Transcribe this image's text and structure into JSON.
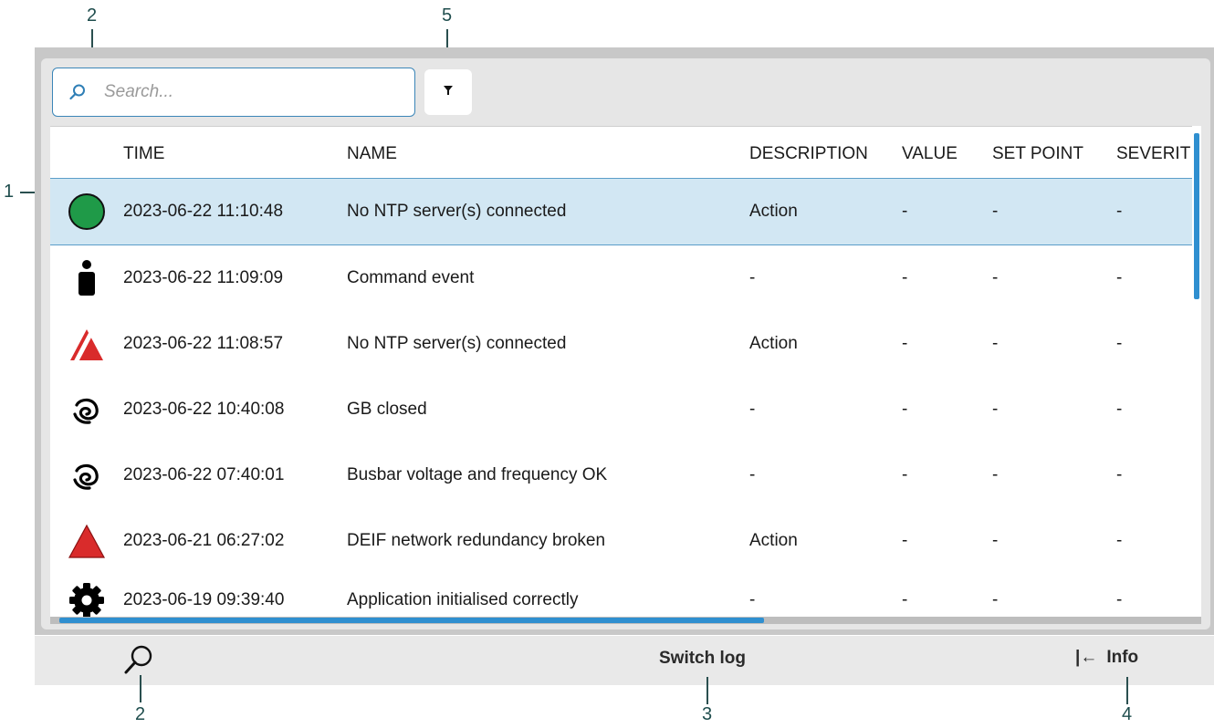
{
  "callouts": {
    "top_search": "2",
    "top_filter": "5",
    "row": "1",
    "bottom_search": "2",
    "bottom_switch": "3",
    "bottom_info": "4"
  },
  "search": {
    "placeholder": "Search..."
  },
  "columns": {
    "time": "TIME",
    "name": "NAME",
    "description": "DESCRIPTION",
    "value": "VALUE",
    "set_point": "SET POINT",
    "severity": "SEVERIT"
  },
  "rows": [
    {
      "icon": "green-circle-icon",
      "time": "2023-06-22 11:10:48",
      "name": "No NTP server(s) connected",
      "description": "Action",
      "value": "-",
      "set_point": "-",
      "severity": "-"
    },
    {
      "icon": "person-icon",
      "time": "2023-06-22 11:09:09",
      "name": "Command event",
      "description": "-",
      "value": "-",
      "set_point": "-",
      "severity": "-"
    },
    {
      "icon": "alarm-acknowledged-icon",
      "time": "2023-06-22 11:08:57",
      "name": "No NTP server(s) connected",
      "description": "Action",
      "value": "-",
      "set_point": "-",
      "severity": "-"
    },
    {
      "icon": "event-swirl-icon",
      "time": "2023-06-22 10:40:08",
      "name": "GB closed",
      "description": "-",
      "value": "-",
      "set_point": "-",
      "severity": "-"
    },
    {
      "icon": "event-swirl-icon",
      "time": "2023-06-22 07:40:01",
      "name": "Busbar voltage and frequency OK",
      "description": "-",
      "value": "-",
      "set_point": "-",
      "severity": "-"
    },
    {
      "icon": "red-triangle-alarm-icon",
      "time": "2023-06-21 06:27:02",
      "name": "DEIF network redundancy broken",
      "description": "Action",
      "value": "-",
      "set_point": "-",
      "severity": "-"
    },
    {
      "icon": "gear-icon",
      "time": "2023-06-19 09:39:40",
      "name": "Application initialised correctly",
      "description": "-",
      "value": "-",
      "set_point": "-",
      "severity": "-"
    }
  ],
  "bottom_bar": {
    "switch_log": "Switch log",
    "info": "Info",
    "info_arrow": "|←"
  },
  "colors": {
    "accent": "#2f8fd0",
    "selected_row": "#d2e7f3",
    "alarm_red": "#d92b2b",
    "ok_green": "#1f9a48"
  }
}
